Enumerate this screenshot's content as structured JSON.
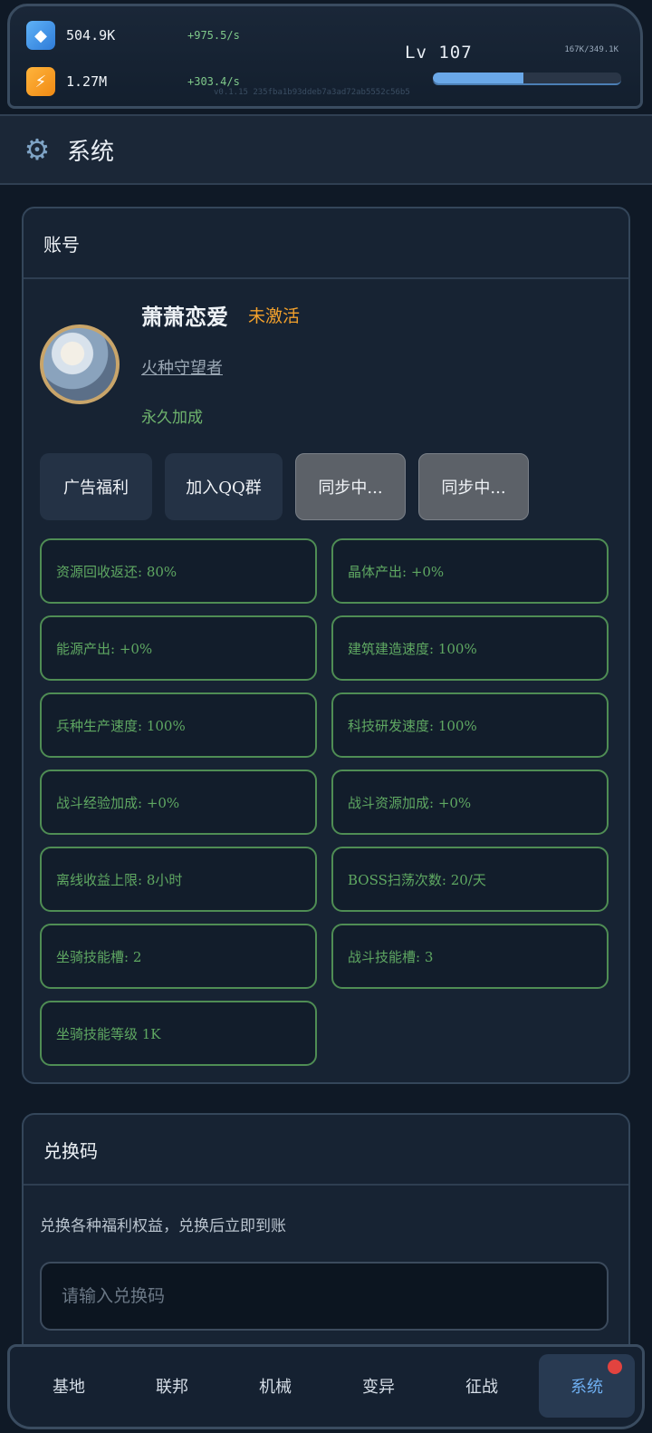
{
  "hud": {
    "gems": {
      "value": "504.9K",
      "rate": "+975.5/s",
      "icon": "gem-icon"
    },
    "energy": {
      "value": "1.27M",
      "rate": "+303.4/s",
      "icon": "bolt-icon"
    },
    "level": "Lv 107",
    "exp_text": "167K/349.1K",
    "exp_fraction": 0.48,
    "version": "v0.1.15 235fba1b93ddeb7a3ad72ab5552c56b5"
  },
  "page": {
    "title": "系统",
    "icon": "gear-icon"
  },
  "account": {
    "header": "账号",
    "name": "萧萧恋爱",
    "status": "未激活",
    "role": "火种守望者",
    "bonus": "永久加成",
    "buttons": [
      "广告福利",
      "加入QQ群",
      "同步中...",
      "同步中..."
    ],
    "stats": [
      "资源回收返还: 80%",
      "晶体产出: +0%",
      "能源产出: +0%",
      "建筑建造速度: 100%",
      "兵种生产速度: 100%",
      "科技研发速度: 100%",
      "战斗经验加成: +0%",
      "战斗资源加成: +0%",
      "离线收益上限: 8小时",
      "BOSS扫荡次数: 20/天",
      "坐骑技能槽: 2",
      "战斗技能槽: 3",
      "坐骑技能等级 1K"
    ]
  },
  "redeem": {
    "header": "兑换码",
    "desc": "兑换各种福利权益，兑换后立即到账",
    "placeholder": "请输入兑换码"
  },
  "nav": {
    "items": [
      "基地",
      "联邦",
      "机械",
      "变异",
      "征战",
      "系统"
    ],
    "active_index": 5
  },
  "colors": {
    "accent": "#6eaef0",
    "stat_green": "#5fa862",
    "warning": "#f3a12c",
    "badge_red": "#e2433f"
  }
}
